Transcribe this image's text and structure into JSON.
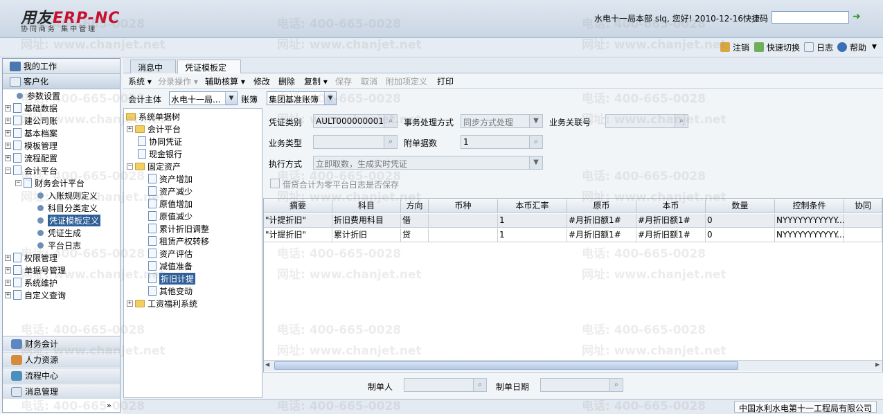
{
  "header": {
    "logo_text_a": "用友",
    "logo_text_b": "ERP-NC",
    "logo_sub": "协同商务   集中管理",
    "user_info": "水电十一局本部 slq, 您好! 2010-12-16",
    "quick_code_label": "快捷码",
    "go_icon": "green-arrow-icon"
  },
  "topbar": {
    "logout": "注销",
    "switch": "快速切换",
    "log": "日志",
    "help": "帮助"
  },
  "left": {
    "my_work": "我的工作",
    "client": "客户化",
    "tree": [
      {
        "label": "参数设置"
      },
      {
        "label": "基础数据"
      },
      {
        "label": "建公司账"
      },
      {
        "label": "基本档案"
      },
      {
        "label": "模板管理"
      },
      {
        "label": "流程配置"
      },
      {
        "label": "会计平台"
      },
      {
        "label": "财务会计平台"
      },
      {
        "label": "入账规则定义"
      },
      {
        "label": "科目分类定义"
      },
      {
        "label": "凭证模板定义"
      },
      {
        "label": "凭证生成"
      },
      {
        "label": "平台日志"
      },
      {
        "label": "权限管理"
      },
      {
        "label": "单据号管理"
      },
      {
        "label": "系统维护"
      },
      {
        "label": "自定义查询"
      }
    ],
    "footer": [
      {
        "label": "财务会计"
      },
      {
        "label": "人力资源"
      },
      {
        "label": "流程中心"
      },
      {
        "label": "消息管理"
      }
    ]
  },
  "tabs": [
    {
      "label": "消息中心"
    },
    {
      "label": "凭证模板定义"
    }
  ],
  "menu": {
    "system": "系统",
    "batch": "分录操作",
    "aux": "辅助核算",
    "edit": "修改",
    "delete": "删除",
    "copy": "复制",
    "save": "保存",
    "cancel": "取消",
    "addon": "附加项定义",
    "print": "打印"
  },
  "filter": {
    "entity_label": "会计主体",
    "entity_value": "水电十一局...",
    "book_label": "账簿",
    "book_value": "集团基准账簿"
  },
  "datatree": [
    {
      "label": "系统单据树"
    },
    {
      "label": "会计平台"
    },
    {
      "label": "协同凭证"
    },
    {
      "label": "现金银行"
    },
    {
      "label": "固定资产"
    },
    {
      "label": "资产增加"
    },
    {
      "label": "资产减少"
    },
    {
      "label": "原值增加"
    },
    {
      "label": "原值减少"
    },
    {
      "label": "累计折旧调整"
    },
    {
      "label": "租赁产权转移"
    },
    {
      "label": "资产评估"
    },
    {
      "label": "减值准备"
    },
    {
      "label": "折旧计提"
    },
    {
      "label": "其他变动"
    },
    {
      "label": "工资福利系统"
    }
  ],
  "form": {
    "voucher_type_label": "凭证类别",
    "voucher_type_value": "AULT000000001\")",
    "process_label": "事务处理方式",
    "process_value": "同步方式处理",
    "bizref_label": "业务关联号",
    "biztype_label": "业务类型",
    "attach_label": "附单据数",
    "attach_value": "1",
    "exec_label": "执行方式",
    "exec_value": "立即取数，生成实时凭证",
    "checkbox_label": "借贷合计为零平台日志是否保存"
  },
  "grid": {
    "headers": [
      "摘要",
      "科目",
      "方向",
      "币种",
      "本币汇率",
      "原币",
      "本币",
      "数量",
      "控制条件",
      "协同"
    ],
    "rows": [
      [
        "\"计提折旧\"",
        "折旧费用科目",
        "借",
        "",
        "1",
        "#月折旧额1#",
        "#月折旧额1#",
        "0",
        "NYYYYYYYYYYY...",
        ""
      ],
      [
        "\"计提折旧\"",
        "累计折旧",
        "贷",
        "",
        "1",
        "#月折旧额1#",
        "#月折旧额1#",
        "0",
        "NYYYYYYYYYYY...",
        ""
      ]
    ]
  },
  "bottom": {
    "maker_label": "制单人",
    "date_label": "制单日期"
  },
  "status": {
    "company": "中国水利水电第十一工程局有限公司"
  },
  "watermark": {
    "phone": "电话: 400-665-0028",
    "site": "网址: www.chanjet.net"
  }
}
